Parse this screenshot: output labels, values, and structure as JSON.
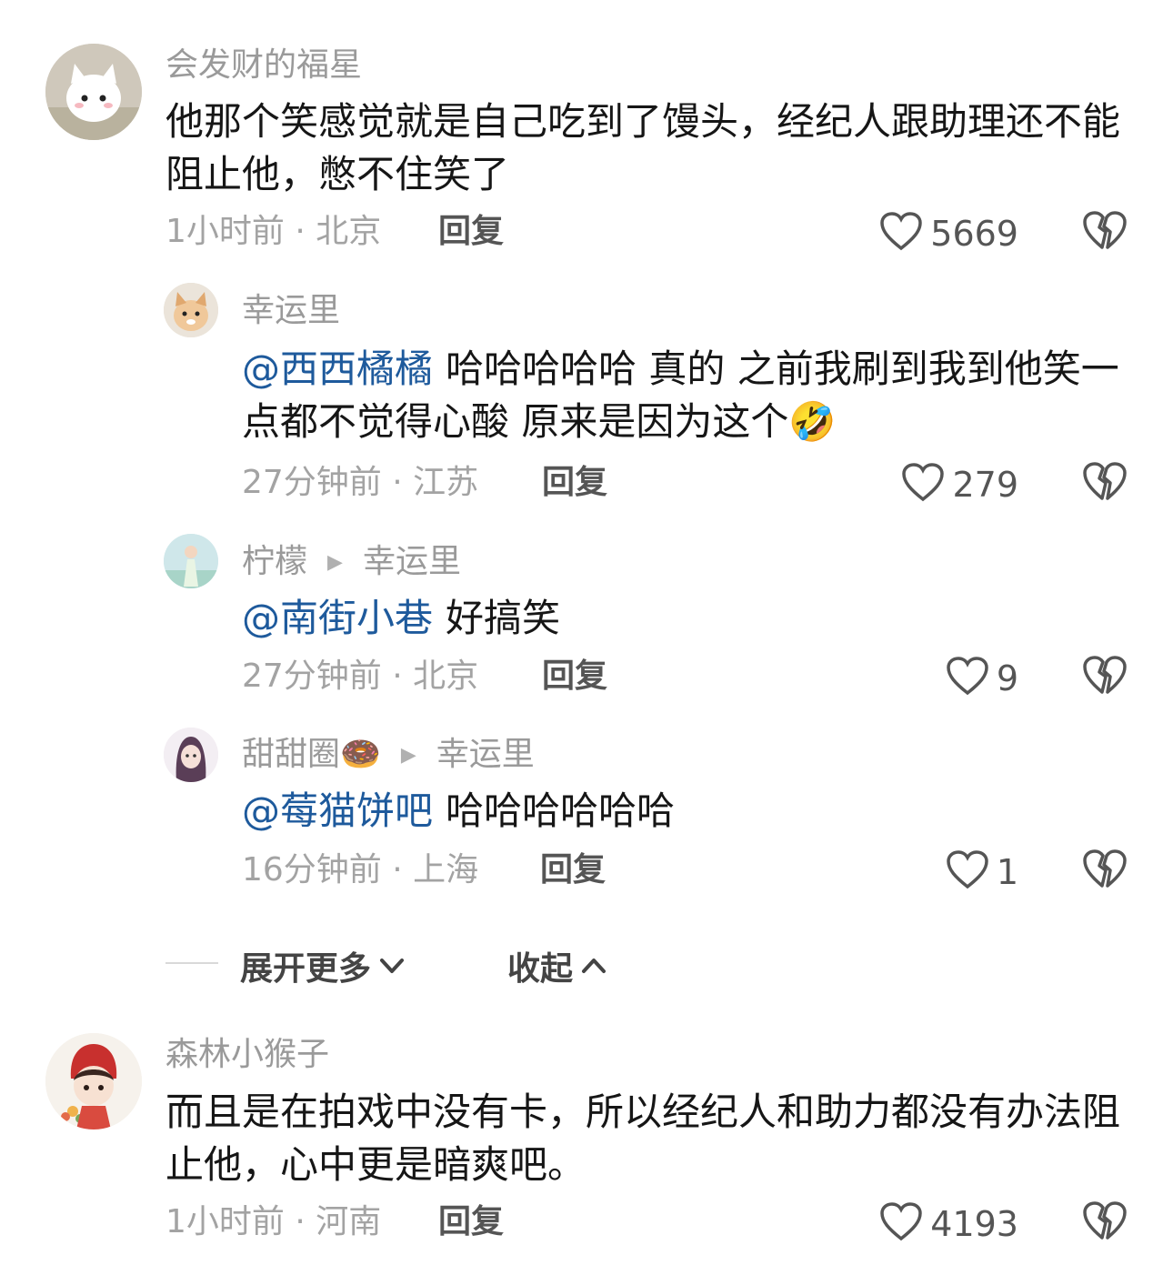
{
  "comments": [
    {
      "username": "会发财的福星",
      "text": "他那个笑感觉就是自己吃到了馒头，经纪人跟助理还不能阻止他，憋不住笑了",
      "time_location": "1小时前 · 北京",
      "reply_label": "回复",
      "likes": "5669"
    },
    {
      "username": "森林小猴子",
      "text": "而且是在拍戏中没有卡，所以经纪人和助力都没有办法阻止他，心中更是暗爽吧。",
      "time_location": "1小时前 · 河南",
      "reply_label": "回复",
      "likes": "4193"
    }
  ],
  "replies": [
    {
      "username": "幸运里",
      "mention": "@西西橘橘",
      "text": "哈哈哈哈哈 真的 之前我刷到我到他笑一点都不觉得心酸 原来是因为这个",
      "emoji": "🤣",
      "time_location": "27分钟前 · 江苏",
      "reply_label": "回复",
      "likes": "279"
    },
    {
      "username": "柠檬",
      "reply_to": "幸运里",
      "mention": "@南街小巷",
      "text": "好搞笑",
      "time_location": "27分钟前 · 北京",
      "reply_label": "回复",
      "likes": "9"
    },
    {
      "username": "甜甜圈",
      "username_emoji": "🍩",
      "reply_to": "幸运里",
      "mention": "@莓猫饼吧",
      "text": "哈哈哈哈哈哈",
      "time_location": "16分钟前 · 上海",
      "reply_label": "回复",
      "likes": "1"
    }
  ],
  "thread_controls": {
    "expand_label": "展开更多",
    "collapse_label": "收起"
  },
  "icons": {
    "like": "heart-outline-icon",
    "dislike": "broken-heart-icon",
    "reply_arrow": "triangle-right-icon",
    "expand": "chevron-down-icon",
    "collapse": "chevron-up-icon"
  },
  "colors": {
    "mention": "#1e5a9c",
    "meta": "#a3a3a3"
  }
}
